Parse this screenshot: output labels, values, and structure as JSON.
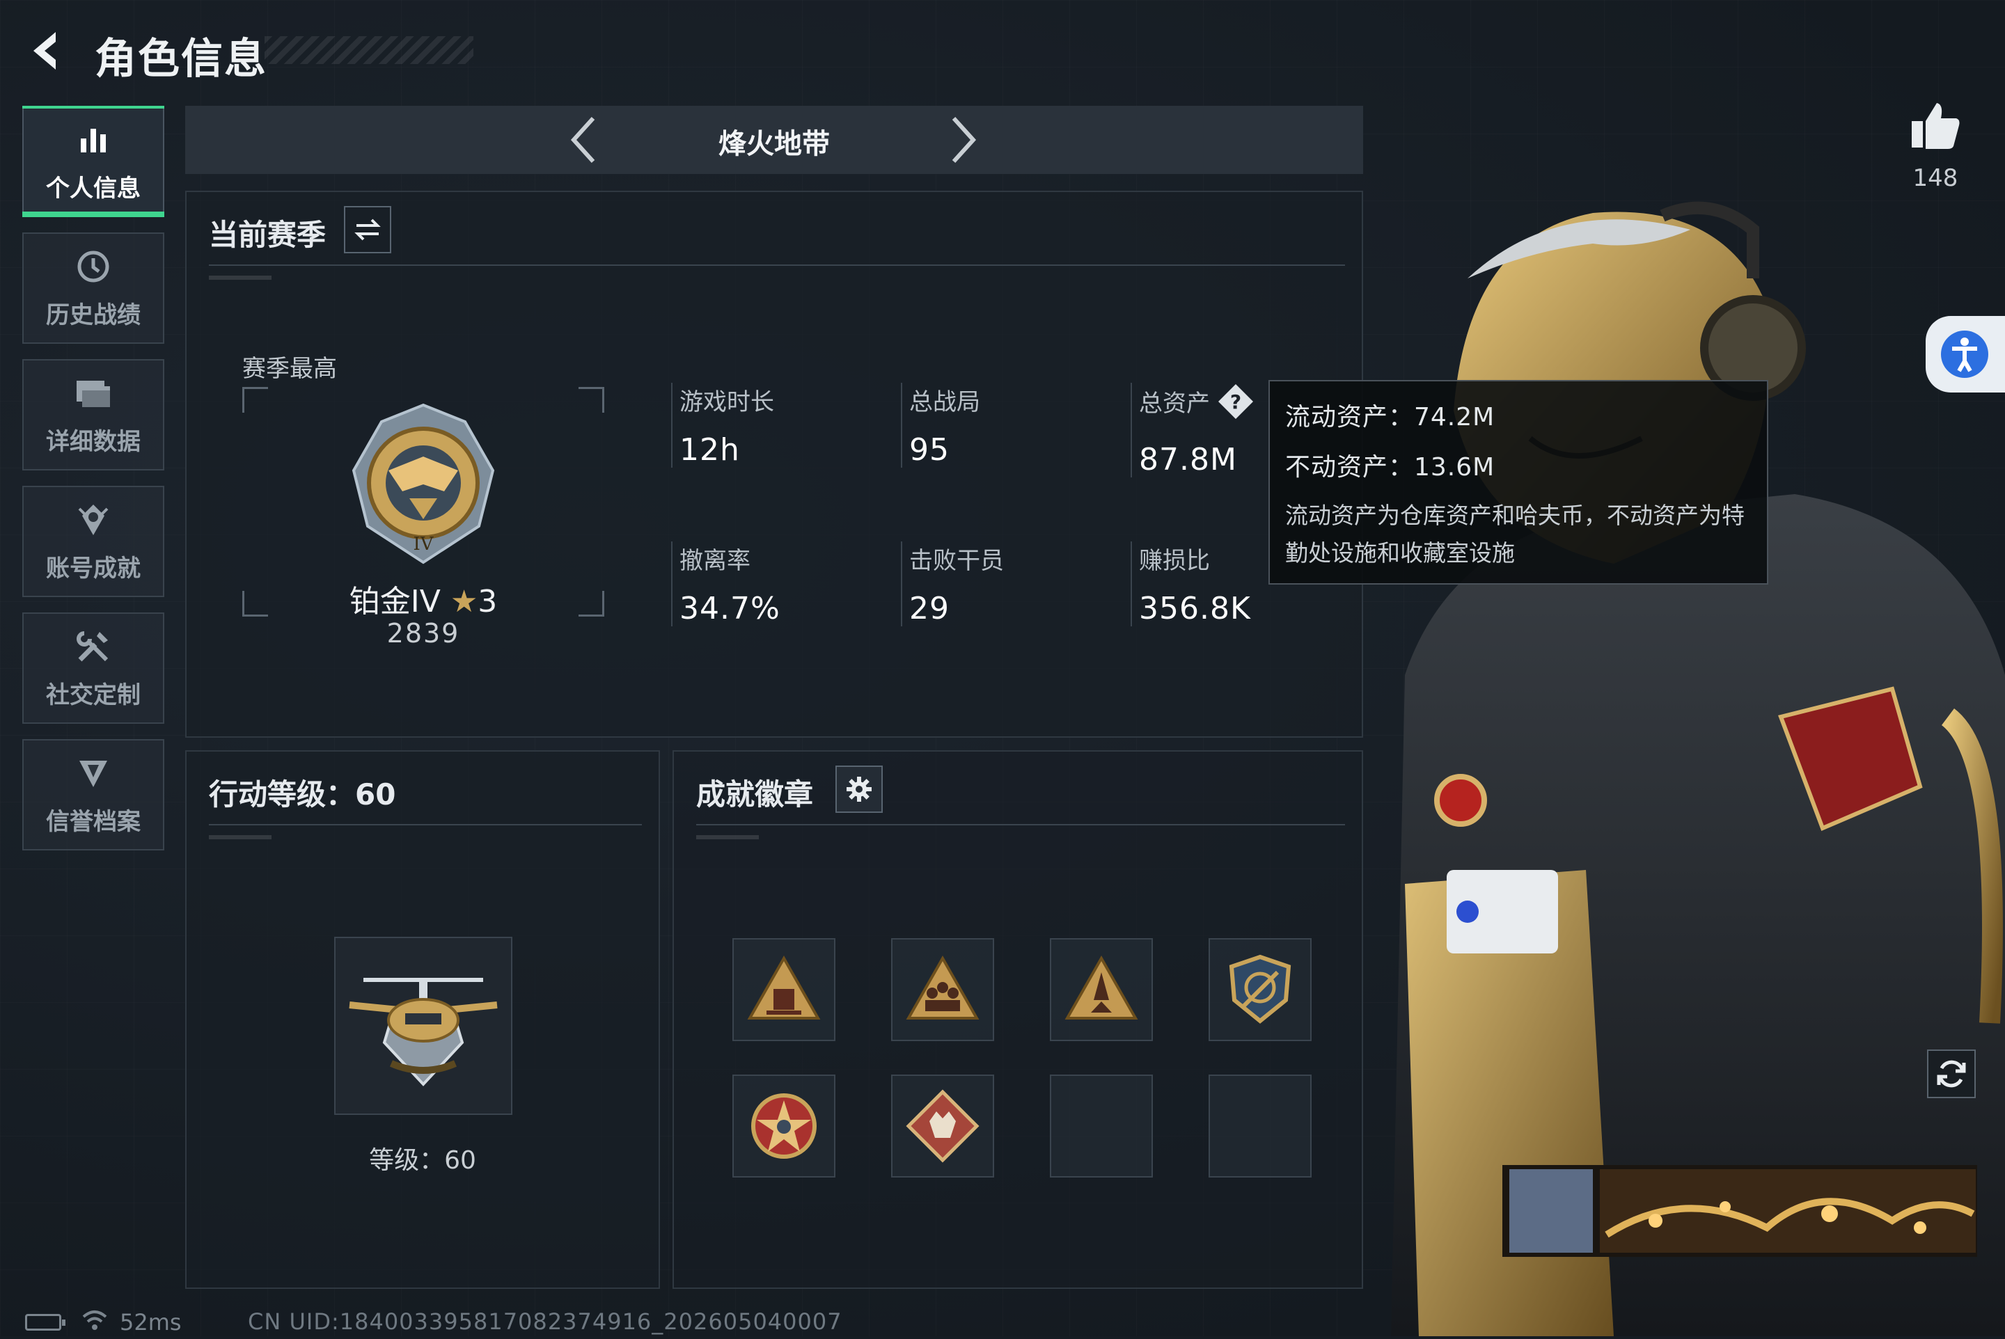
{
  "header": {
    "title": "角色信息",
    "back_icon": "back-arrow-icon"
  },
  "sidebar": {
    "items": [
      {
        "label": "个人信息",
        "icon": "bar-chart-icon",
        "active": true
      },
      {
        "label": "历史战绩",
        "icon": "history-clock-icon",
        "active": false
      },
      {
        "label": "详细数据",
        "icon": "folder-icon",
        "active": false
      },
      {
        "label": "账号成就",
        "icon": "achievement-icon",
        "active": false
      },
      {
        "label": "社交定制",
        "icon": "tools-icon",
        "active": false
      },
      {
        "label": "信誉档案",
        "icon": "reputation-icon",
        "active": false
      }
    ]
  },
  "mode": {
    "title": "烽火地带"
  },
  "season": {
    "heading": "当前赛季",
    "best_label": "赛季最高",
    "rank_name": "铂金IV",
    "rank_stars": "3",
    "rank_score": "2839",
    "stats": [
      {
        "key": "游戏时长",
        "value": "12h"
      },
      {
        "key": "总战局",
        "value": "95"
      },
      {
        "key": "总资产",
        "value": "87.8M"
      },
      {
        "key": "撤离率",
        "value": "34.7%"
      },
      {
        "key": "击败干员",
        "value": "29"
      },
      {
        "key": "赚损比",
        "value": "356.8K"
      }
    ]
  },
  "tooltip": {
    "liquid": "流动资产：74.2M",
    "fixed": "不动资产：13.6M",
    "desc": "流动资产为仓库资产和哈夫币，不动资产为特勤处设施和收藏室设施"
  },
  "level": {
    "heading": "行动等级：60",
    "text": "等级：60"
  },
  "badges": {
    "heading": "成就徽章",
    "filled_count": 6,
    "slot_count": 8
  },
  "social": {
    "like_count": "148"
  },
  "footer": {
    "ping": "52ms",
    "uid": "CN UID:18400339581708237491​6_202605040007"
  },
  "colors": {
    "accent": "#3fd58f",
    "panel": "#181e25",
    "background": "#161c23",
    "gold": "#c9a45a"
  }
}
